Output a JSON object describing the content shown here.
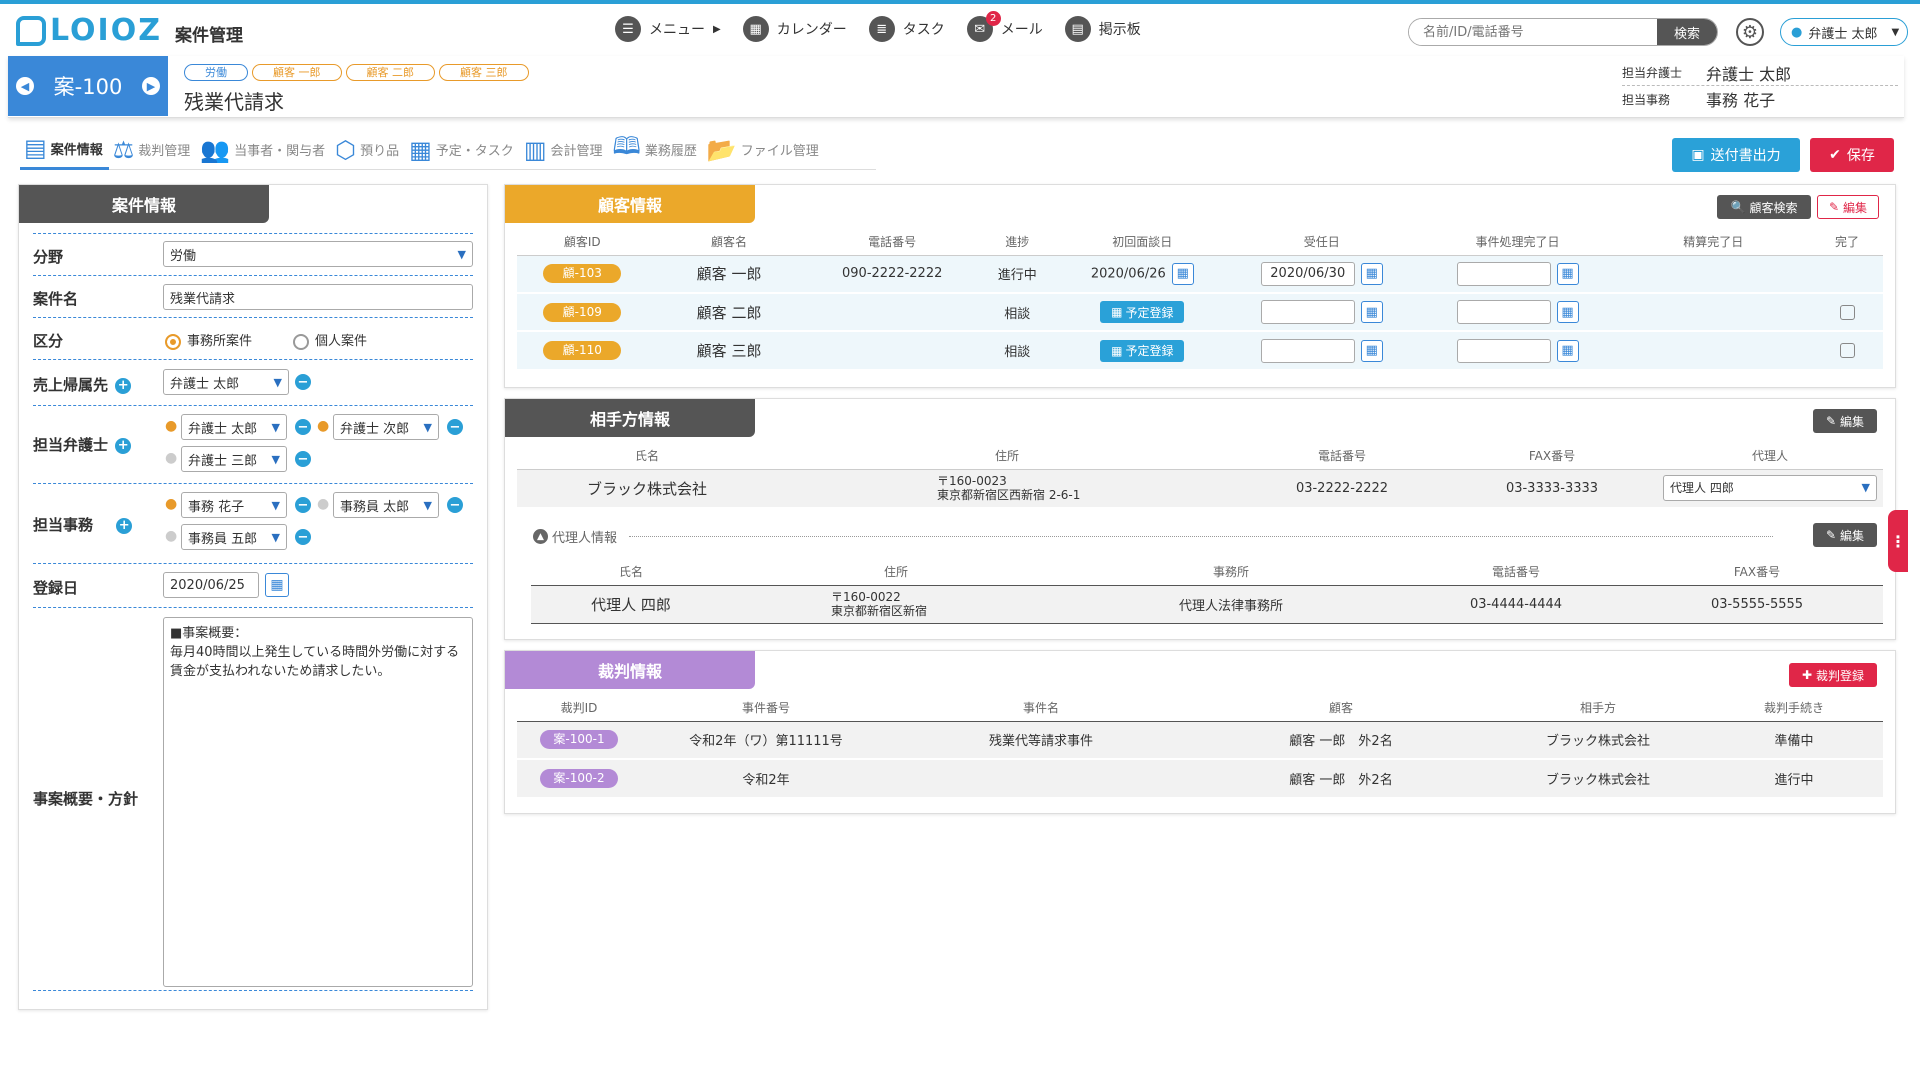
{
  "app": {
    "logo": "LOIOZ",
    "title": "案件管理"
  },
  "nav": [
    {
      "label": "メニュー",
      "icon": "menu-icon"
    },
    {
      "label": "カレンダー",
      "icon": "calendar-icon"
    },
    {
      "label": "タスク",
      "icon": "task-icon"
    },
    {
      "label": "メール",
      "icon": "mail-icon",
      "badge": "2"
    },
    {
      "label": "掲示板",
      "icon": "board-icon"
    }
  ],
  "search": {
    "placeholder": "名前/ID/電話番号",
    "button": "検索"
  },
  "user": {
    "name": "弁護士 太郎"
  },
  "case": {
    "id": "案-100",
    "tags": [
      "労働",
      "顧客 一郎",
      "顧客 二郎",
      "顧客 三郎"
    ],
    "name": "残業代請求",
    "lawyer_label": "担当弁護士",
    "lawyer": "弁護士 太郎",
    "staff_label": "担当事務",
    "staff": "事務 花子"
  },
  "tabs": [
    "案件情報",
    "裁判管理",
    "当事者・関与者",
    "預り品",
    "予定・タスク",
    "会計管理",
    "業務履歴",
    "ファイル管理"
  ],
  "actions": {
    "output": "送付書出力",
    "save": "保存"
  },
  "left": {
    "title": "案件情報",
    "field_label": "分野",
    "field": "労働",
    "name_label": "案件名",
    "name": "残業代請求",
    "type_label": "区分",
    "type_opt1": "事務所案件",
    "type_opt2": "個人案件",
    "sales_label": "売上帰属先",
    "sales": "弁護士 太郎",
    "lawyers_label": "担当弁護士",
    "lawyers": [
      "弁護士 太郎",
      "弁護士 次郎",
      "弁護士 三郎"
    ],
    "staffs_label": "担当事務",
    "staffs": [
      "事務 花子",
      "事務員 太郎",
      "事務員 五郎"
    ],
    "date_label": "登録日",
    "date": "2020/06/25",
    "summary_label": "事案概要・方針",
    "summary": "■事案概要：\n毎月40時間以上発生している時間外労働に対する賃金が支払われないため請求したい。"
  },
  "customer": {
    "title": "顧客情報",
    "search_btn": "顧客検索",
    "edit_btn": "編集",
    "headers": [
      "顧客ID",
      "顧客名",
      "電話番号",
      "進捗",
      "初回面談日",
      "受任日",
      "事件処理完了日",
      "精算完了日",
      "完了"
    ],
    "schedule_btn": "予定登録",
    "rows": [
      {
        "id": "顧-103",
        "name": "顧客 一郎",
        "phone": "090-2222-2222",
        "status": "進行中",
        "first": "2020/06/26",
        "accepted": "2020/06/30"
      },
      {
        "id": "顧-109",
        "name": "顧客 二郎",
        "phone": "",
        "status": "相談",
        "first": "",
        "accepted": ""
      },
      {
        "id": "顧-110",
        "name": "顧客 三郎",
        "phone": "",
        "status": "相談",
        "first": "",
        "accepted": ""
      }
    ]
  },
  "opponent": {
    "title": "相手方情報",
    "edit_btn": "編集",
    "headers": [
      "氏名",
      "住所",
      "電話番号",
      "FAX番号",
      "代理人"
    ],
    "row": {
      "name": "ブラック株式会社",
      "zip": "〒160-0023",
      "addr": "東京都新宿区西新宿 2-6-1",
      "phone": "03-2222-2222",
      "fax": "03-3333-3333",
      "agent": "代理人 四郎"
    },
    "agent_title": "代理人情報",
    "agent_edit": "編集",
    "agent_headers": [
      "氏名",
      "住所",
      "事務所",
      "電話番号",
      "FAX番号"
    ],
    "agent_row": {
      "name": "代理人 四郎",
      "zip": "〒160-0022",
      "addr": "東京都新宿区新宿",
      "office": "代理人法律事務所",
      "phone": "03-4444-4444",
      "fax": "03-5555-5555"
    }
  },
  "trial": {
    "title": "裁判情報",
    "add_btn": "裁判登録",
    "headers": [
      "裁判ID",
      "事件番号",
      "事件名",
      "顧客",
      "相手方",
      "裁判手続き"
    ],
    "rows": [
      {
        "id": "案-100-1",
        "no": "令和2年（ワ）第11111号",
        "name": "残業代等請求事件",
        "client": "顧客 一郎　外2名",
        "opp": "ブラック株式会社",
        "proc": "準備中"
      },
      {
        "id": "案-100-2",
        "no": "令和2年",
        "name": "",
        "client": "顧客 一郎　外2名",
        "opp": "ブラック株式会社",
        "proc": "進行中"
      }
    ]
  },
  "colors": {
    "accent": "#2a9fd6",
    "case_blue": "#3a88d8",
    "orange": "#eba82a",
    "purple": "#b38ad6",
    "red": "#e02648",
    "dark": "#555555"
  }
}
